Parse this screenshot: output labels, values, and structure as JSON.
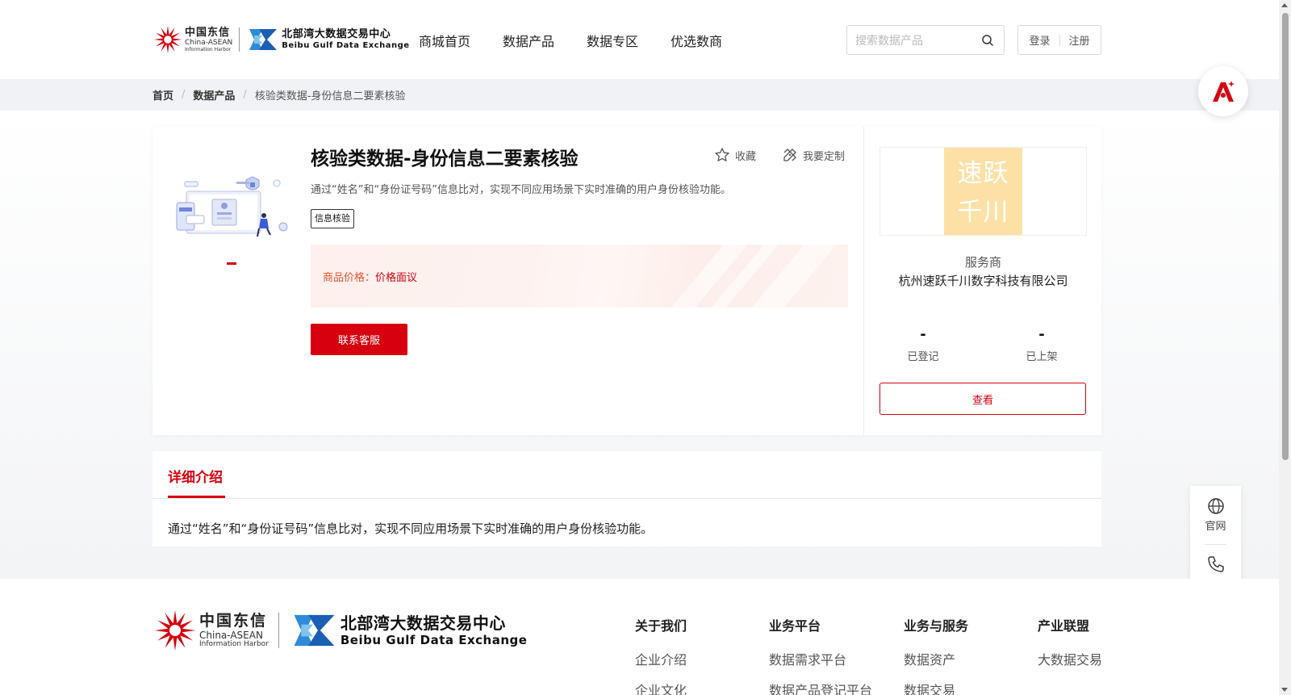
{
  "header": {
    "logo_cn": "中国东信",
    "logo_cn_en": "China-ASEAN",
    "logo_cn_sub": "Information Harbor",
    "logo_bx_cn": "北部湾大数据交易中心",
    "logo_bx_en": "Beibu Gulf Data Exchange",
    "nav": [
      "商城首页",
      "数据产品",
      "数据专区",
      "优选数商"
    ],
    "search_placeholder": "搜索数据产品",
    "login": "登录",
    "register": "注册"
  },
  "breadcrumb": [
    "首页",
    "数据产品",
    "核验类数据-身份信息二要素核验"
  ],
  "product": {
    "title": "核验类数据-身份信息二要素核验",
    "favorite": "收藏",
    "customize": "我要定制",
    "description": "通过“姓名”和“身份证号码”信息比对，实现不同应用场景下实时准确的用户身份核验功能。",
    "tag": "信息核验",
    "price_label": "商品价格：",
    "price_value": "价格面议",
    "contact_button": "联系客服"
  },
  "provider": {
    "logo_line1": "速跃",
    "logo_line2": "千川",
    "label": "服务商",
    "name": "杭州速跃千川数字科技有限公司",
    "stats": [
      {
        "value": "-",
        "label": "已登记"
      },
      {
        "value": "-",
        "label": "已上架"
      }
    ],
    "view_button": "查看"
  },
  "detail": {
    "tab": "详细介绍",
    "text": "通过“姓名”和“身份证号码”信息比对，实现不同应用场景下实时准确的用户身份核验功能。"
  },
  "side_float": {
    "website": "官网",
    "contact": "联系"
  },
  "footer": {
    "columns": [
      {
        "heading": "关于我们",
        "link1": "企业介绍",
        "link2": "企业文化"
      },
      {
        "heading": "业务平台",
        "link1": "数据需求平台",
        "link2": "数据产品登记平台"
      },
      {
        "heading": "业务与服务",
        "link1": "数据资产",
        "link2": "数据交易"
      },
      {
        "heading": "产业联盟",
        "link1": "大数据交易",
        "link2": ""
      }
    ]
  },
  "colors": {
    "brand_red": "#d7000f",
    "price_orange": "#e8542e",
    "provider_logo_bg": "#fce0a6"
  }
}
